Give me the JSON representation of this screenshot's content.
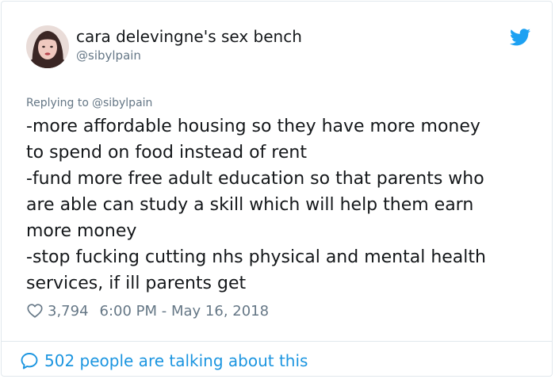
{
  "author": {
    "display_name": "cara delevingne's sex bench",
    "handle": "@sibylpain"
  },
  "reply": {
    "prefix": "Replying to",
    "handle": "@sibylpain"
  },
  "tweet": {
    "lines": [
      "-more affordable housing so they have more money",
      "to spend on food instead of rent",
      "-fund more free adult education so that parents who",
      "are able can study a skill which will help them earn",
      "more money",
      "-stop fucking cutting nhs physical and mental health",
      "services, if ill parents get"
    ]
  },
  "meta": {
    "likes": "3,794",
    "timestamp": "6:00 PM - May 16, 2018"
  },
  "footer": {
    "talking_label": "502 people are talking about this"
  },
  "icons": {
    "brand": "twitter-bird-icon",
    "like": "heart-icon",
    "conversation": "speech-bubble-icon"
  },
  "colors": {
    "twitter_blue": "#1da1f2",
    "link_blue": "#1b95e0",
    "secondary_text": "#657786",
    "primary_text": "#14171a"
  }
}
